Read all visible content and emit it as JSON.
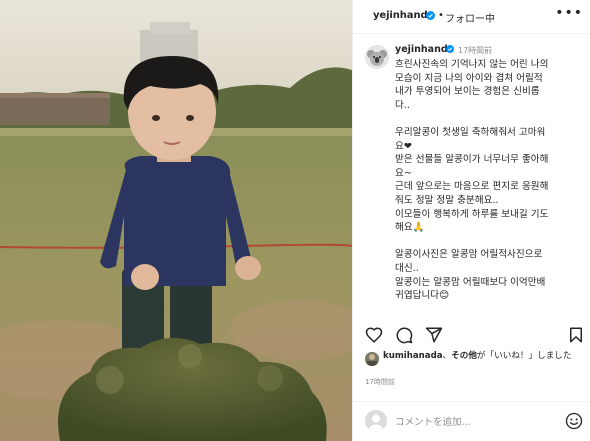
{
  "post": {
    "username": "yejinhand",
    "follow_sep": "•",
    "follow_label": "フォロー中",
    "more_label": "•••"
  },
  "caption": {
    "username": "yejinhand",
    "time": "17時間前",
    "lines": [
      "흐린사진속의 기억나지 않는 어린 나의",
      "모습이 지금 나의 아이와 겹쳐 어릴적",
      "내가 투영되어 보이는 경험은 신비롭",
      "다..",
      "",
      "우리알콩이 첫생일 축하해줘서 고마워",
      "요❤",
      "받은 선물들 알콩이가 너무너무 좋아해",
      "요~",
      "근데 앞으로는 마음으로 편지로 응원해",
      "줘도 정말 정말 충분해요..",
      "이모들이 행복하게 하루를 보내길 기도",
      "해요🙏",
      "",
      "알콩이사진은 알콩맘 어릴적사진으로",
      "대신..",
      "알콩이는 알콩맘 어릴때보다 이억만배",
      "귀엽답니다😊"
    ]
  },
  "likes": {
    "liker": "kumihanada",
    "connector": "、",
    "others": "その他",
    "suffix": "が「いいね！」しました",
    "time": "17時間前"
  },
  "comment": {
    "placeholder": "コメントを追加..."
  },
  "icons": {
    "verified": "verified-badge-icon",
    "more": "more-options-icon",
    "like": "heart-icon",
    "comment": "comment-bubble-icon",
    "share": "paper-plane-icon",
    "save": "bookmark-icon",
    "emoji": "emoji-smile-icon"
  },
  "colors": {
    "verified_blue": "#0095f6",
    "text": "#262626",
    "secondary_text": "#8e8e8e",
    "divider": "#efefef"
  }
}
